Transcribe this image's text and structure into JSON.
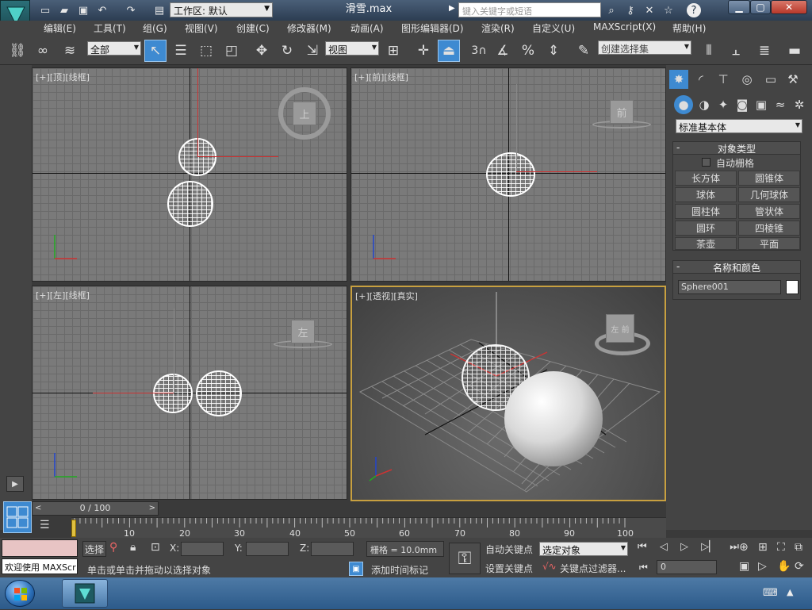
{
  "window": {
    "workspace": "工作区: 默认",
    "filename": "滑雪.max",
    "search_placeholder": "键入关键字或短语"
  },
  "menu": [
    "编辑(E)",
    "工具(T)",
    "组(G)",
    "视图(V)",
    "创建(C)",
    "修改器(M)",
    "动画(A)",
    "图形编辑器(D)",
    "渲染(R)",
    "自定义(U)",
    "MAXScript(X)",
    "帮助(H)"
  ],
  "toolbar": {
    "selection_filter": "全部",
    "ref_coord": "视图",
    "snap_number": "3",
    "selection_set_placeholder": "创建选择集"
  },
  "viewports": {
    "top": "[+][顶][线框]",
    "front": "[+][前][线框]",
    "left": "[+][左][线框]",
    "perspective": "[+][透视][真实]",
    "cube_top": "上",
    "cube_front": "前",
    "cube_left": "左",
    "cube_persp_a": "左",
    "cube_persp_b": "前"
  },
  "command_panel": {
    "category": "标准基本体",
    "object_type_title": "对象类型",
    "auto_grid": "自动栅格",
    "buttons": [
      "长方体",
      "圆锥体",
      "球体",
      "几何球体",
      "圆柱体",
      "管状体",
      "圆环",
      "四棱锥",
      "茶壶",
      "平面"
    ],
    "name_color_title": "名称和颜色",
    "object_name": "Sphere001",
    "object_color": "#ffffff"
  },
  "timeline": {
    "slider": "0 / 100",
    "ticks": [
      "10",
      "20",
      "30",
      "40",
      "50",
      "60",
      "70",
      "80",
      "90",
      "100"
    ]
  },
  "status": {
    "listener": "欢迎使用 MAXScr",
    "prompt": "单击或单击并拖动以选择对象",
    "sel_label": "选择",
    "x_label": "X:",
    "y_label": "Y:",
    "z_label": "Z:",
    "grid": "栅格 = 10.0mm",
    "add_time_tag": "添加时间标记",
    "auto_key": "自动关键点",
    "set_key": "设置关键点",
    "key_mode": "选定对象",
    "key_filters": "关键点过滤器...",
    "frame": "0"
  },
  "colors": {
    "accent": "#3e8ad1",
    "viewport_active_border": "#c8a040",
    "axis_x": "#cc2222",
    "axis_y": "#22aa22",
    "axis_z": "#2244cc"
  }
}
